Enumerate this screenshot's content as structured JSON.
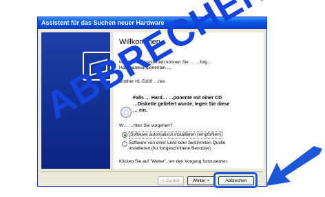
{
  "window": {
    "title": "Assistent für das Suchen neuer Hardware"
  },
  "main": {
    "heading": "Willkommen",
    "intro_line1": "Mit diesem Assistenten können Sie …       …folg…",
    "intro_line2": "Hardwarekomponenten …",
    "device": "Brother  HL-5100  …ries",
    "cd_text_line1": "Falls … Hard… …ponente mit einer CD",
    "cd_text_line2": "…Diskette geliefert wurde, legen Sie diese",
    "cd_text_line3": "… ein.",
    "question": "W…  …hten Sie vorgehen?",
    "options": [
      {
        "label_line1": "Software automatisch installieren (empfohlen)",
        "label_line2": "",
        "selected": true
      },
      {
        "label_line1": "Software von einer Liste oder bestimmten Quelle",
        "label_line2": "installieren (für fortgeschrittene Benutzer)",
        "selected": false
      }
    ],
    "continue_hint": "Klicken Sie auf \"Weiter\", um den Vorgang fortzusetzen."
  },
  "buttons": {
    "back": "< Zurück",
    "next": "Weiter >",
    "cancel": "Abbrechen"
  },
  "overlay": {
    "text": "ABBRECHEN",
    "color": "#1444dd"
  },
  "icons": {
    "hardware": "hardware-wizard-icon",
    "cd": "cd-icon",
    "arrow": "arrow-icon"
  }
}
